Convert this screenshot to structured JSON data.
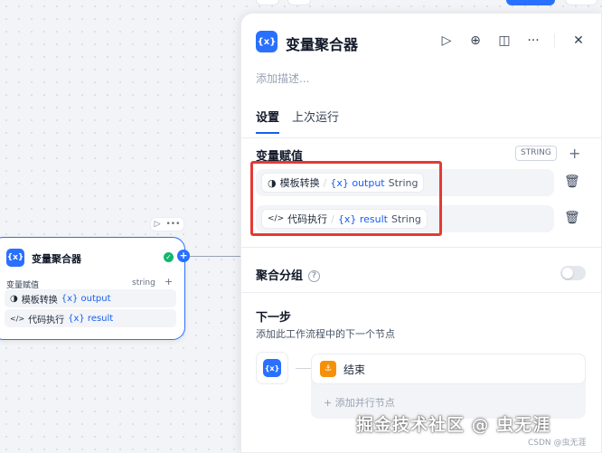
{
  "node": {
    "title": "变量聚合器",
    "icon_text": "{x}",
    "var_label": "变量赋值",
    "type_label": "string",
    "plus": "+",
    "connector": "+",
    "rows": [
      {
        "icon": "◑",
        "source": "模板转换",
        "var": "{x} output"
      },
      {
        "icon": "</>",
        "source": "代码执行",
        "var": "{x} result"
      }
    ],
    "toolbar": {
      "run": "▷",
      "more": "•••"
    },
    "check": "✓"
  },
  "panel": {
    "icon_text": "{x}",
    "title": "变量聚合器",
    "desc_placeholder": "添加描述...",
    "tools": {
      "run": "▷",
      "locate": "⊕",
      "split": "◫",
      "more": "···",
      "close": "✕"
    },
    "tabs": [
      {
        "label": "设置",
        "active": true
      },
      {
        "label": "上次运行",
        "active": false
      }
    ],
    "var_section": {
      "title": "变量赋值",
      "type_badge": "STRING",
      "add": "+",
      "items": [
        {
          "icon": "◑",
          "source": "模板转换",
          "sep": "/",
          "var": "{x} output",
          "type": "String"
        },
        {
          "icon": "</>",
          "source": "代码执行",
          "sep": "/",
          "var": "{x} result",
          "type": "String"
        }
      ],
      "trash": "🗑"
    },
    "group": {
      "title": "聚合分组",
      "help": "?"
    },
    "next": {
      "title": "下一步",
      "desc": "添加此工作流程中的下一个节点",
      "src_icon": "{x}",
      "end_label": "结束",
      "end_icon": "⚓",
      "add_parallel": "+   添加并行节点"
    }
  },
  "watermark": "掘金技术社区 @ 虫无涯",
  "csdn": "CSDN @虫无涯"
}
